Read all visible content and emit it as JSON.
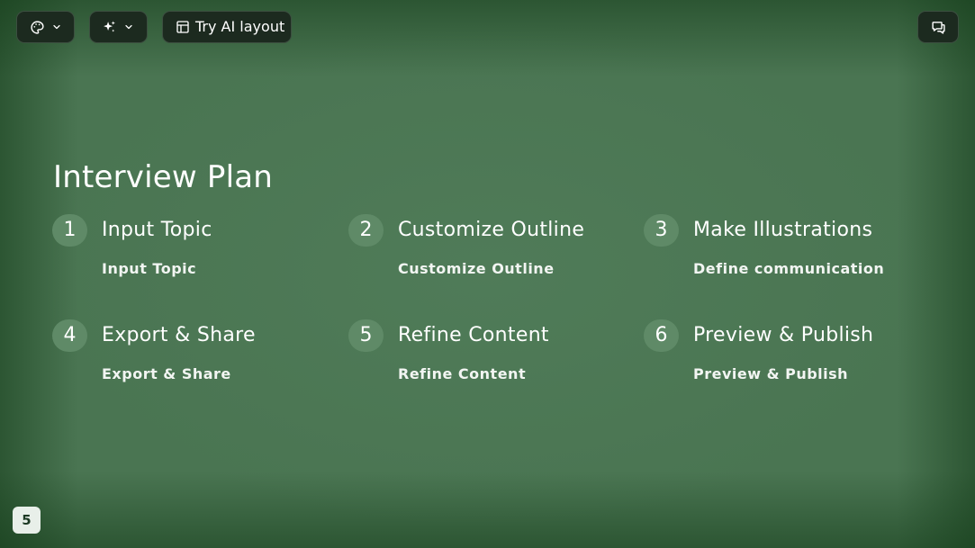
{
  "toolbar": {
    "theme_icon": "palette-icon",
    "ai_icon": "sparkles-icon",
    "layout_icon": "layout-icon",
    "layout_label": "Try AI layout",
    "comment_icon": "comments-icon",
    "dropdown_icon": "chevron-down-icon",
    "button_bg": "#1c2a1f"
  },
  "slide": {
    "title": "Interview Plan",
    "background": "#4a7552",
    "badge_color": "#5f8a67",
    "steps": [
      {
        "number": "1",
        "heading": "Input Topic",
        "description": "Input Topic"
      },
      {
        "number": "2",
        "heading": "Customize Outline",
        "description": "Customize Outline"
      },
      {
        "number": "3",
        "heading": "Make Illustrations",
        "description": "Define communication"
      },
      {
        "number": "4",
        "heading": "Export & Share",
        "description": "Export & Share"
      },
      {
        "number": "5",
        "heading": "Refine Content",
        "description": "Refine Content"
      },
      {
        "number": "6",
        "heading": "Preview & Publish",
        "description": "Preview & Publish"
      }
    ]
  },
  "page_number": "5"
}
